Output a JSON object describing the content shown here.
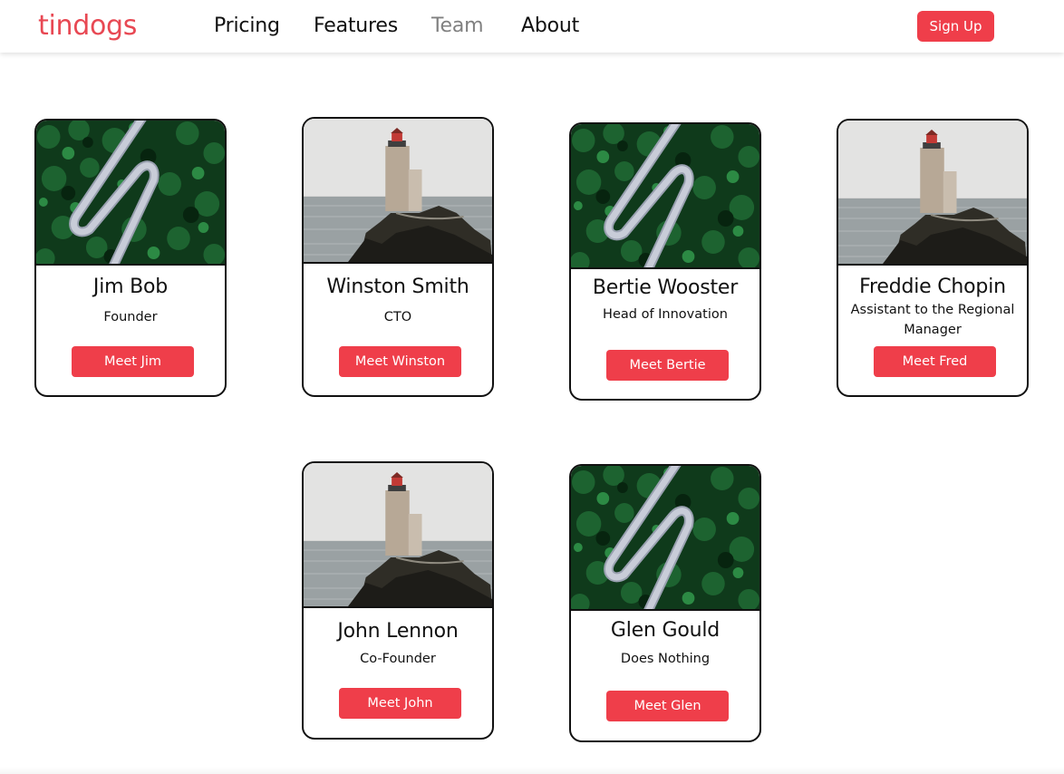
{
  "navbar": {
    "brand": "tindogs",
    "links": [
      {
        "label": "Pricing",
        "active": false
      },
      {
        "label": "Features",
        "active": false
      },
      {
        "label": "Team",
        "active": true
      },
      {
        "label": "About",
        "active": false
      }
    ],
    "signup_label": "Sign Up"
  },
  "team": [
    {
      "name": "Jim Bob",
      "role": "Founder",
      "button": "Meet Jim",
      "image": "forest-road-image"
    },
    {
      "name": "Winston Smith",
      "role": "CTO",
      "button": "Meet Winston",
      "image": "lighthouse-image"
    },
    {
      "name": "Bertie Wooster",
      "role": "Head of Innovation",
      "button": "Meet Bertie",
      "image": "forest-road-image"
    },
    {
      "name": "Freddie Chopin",
      "role": "Assistant to the Regional Manager",
      "button": "Meet Fred",
      "image": "lighthouse-image"
    },
    {
      "name": "John Lennon",
      "role": "Co-Founder",
      "button": "Meet John",
      "image": "lighthouse-image"
    },
    {
      "name": "Glen Gould",
      "role": "Does Nothing",
      "button": "Meet Glen",
      "image": "forest-road-image"
    }
  ],
  "colors": {
    "brand": "#e84853",
    "accent": "#ef3e4a",
    "inactive_link": "#808080",
    "text": "#111111",
    "card_border": "#111111"
  }
}
